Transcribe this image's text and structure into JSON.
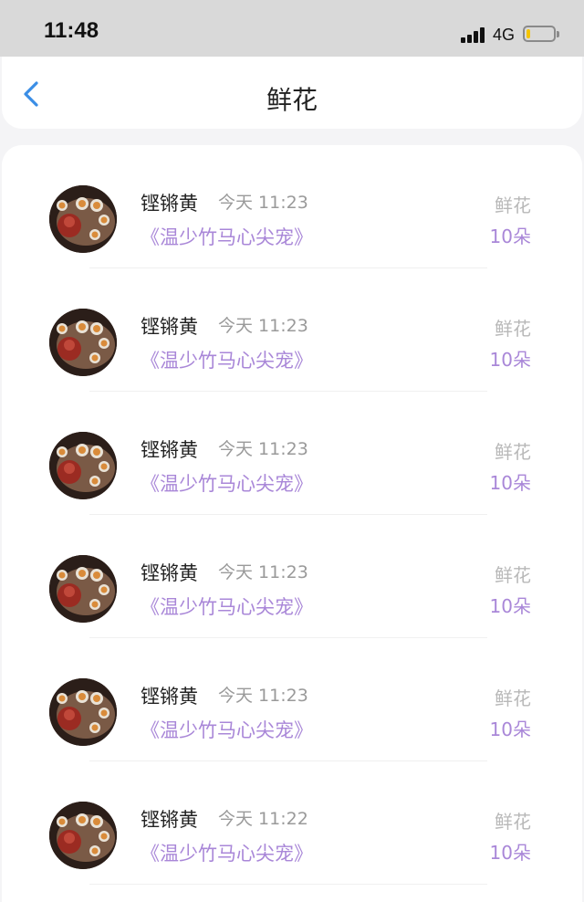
{
  "status_bar": {
    "time": "11:48",
    "network": "4G",
    "battery_level": 0.15,
    "signal_bars": 4
  },
  "nav": {
    "title": "鲜花",
    "back_icon": "chevron-left-icon",
    "accent_color": "#3a8ee6"
  },
  "colors": {
    "link_purple": "#a987d8",
    "muted_gray": "#9a9a9a"
  },
  "records": [
    {
      "user": "铿锵黄",
      "time": "今天 11:23",
      "book": "《温少竹马心尖宠》",
      "gift": "鲜花",
      "count": "10朵"
    },
    {
      "user": "铿锵黄",
      "time": "今天 11:23",
      "book": "《温少竹马心尖宠》",
      "gift": "鲜花",
      "count": "10朵"
    },
    {
      "user": "铿锵黄",
      "time": "今天 11:23",
      "book": "《温少竹马心尖宠》",
      "gift": "鲜花",
      "count": "10朵"
    },
    {
      "user": "铿锵黄",
      "time": "今天 11:23",
      "book": "《温少竹马心尖宠》",
      "gift": "鲜花",
      "count": "10朵"
    },
    {
      "user": "铿锵黄",
      "time": "今天 11:23",
      "book": "《温少竹马心尖宠》",
      "gift": "鲜花",
      "count": "10朵"
    },
    {
      "user": "铿锵黄",
      "time": "今天 11:22",
      "book": "《温少竹马心尖宠》",
      "gift": "鲜花",
      "count": "10朵"
    }
  ]
}
